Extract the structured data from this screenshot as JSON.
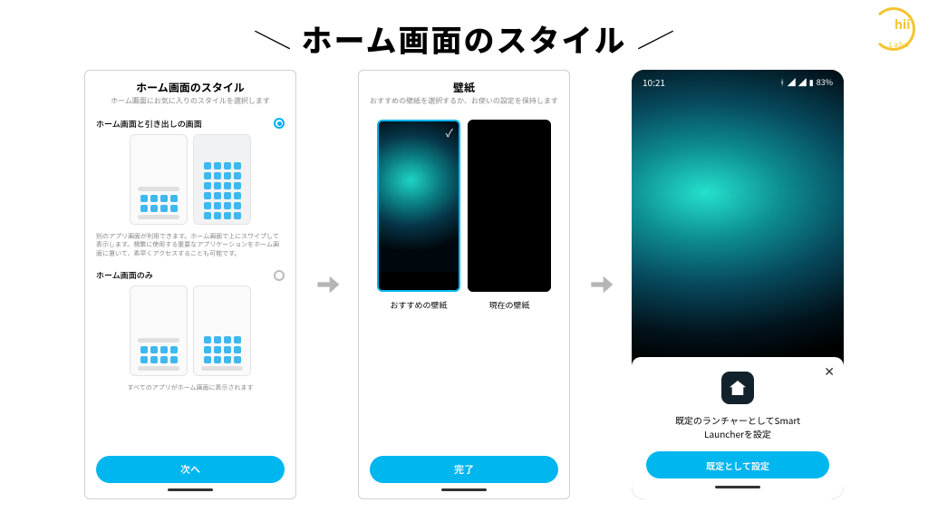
{
  "page": {
    "title": "ホーム画面のスタイル"
  },
  "logo": {
    "text": "hii",
    "sub": "Labo"
  },
  "screen1": {
    "title": "ホーム画面のスタイル",
    "subtitle": "ホーム画面にお気に入りのスタイルを選択します",
    "option1_label": "ホーム画面と引き出しの画面",
    "option1_desc": "別のアプリ画面が利用できます。ホーム画面で上にスワイプして表示します。頻繁に使用する重要なアプリケーションをホーム画面に置いて、素早くアクセスすることも可能です。",
    "option2_label": "ホーム画面のみ",
    "option2_desc": "すべてのアプリがホーム画面に表示されます",
    "next_button": "次へ"
  },
  "screen2": {
    "title": "壁紙",
    "subtitle": "おすすめの壁紙を選択するか、お使いの設定を保持します",
    "wall1_label": "おすすめの壁紙",
    "wall2_label": "現在の壁紙",
    "done_button": "完了"
  },
  "screen3": {
    "time": "10:21",
    "battery": "83%",
    "dialog_text_1": "既定のランチャーとしてSmart",
    "dialog_text_2": "Launcherを設定",
    "set_default_button": "既定として設定"
  }
}
